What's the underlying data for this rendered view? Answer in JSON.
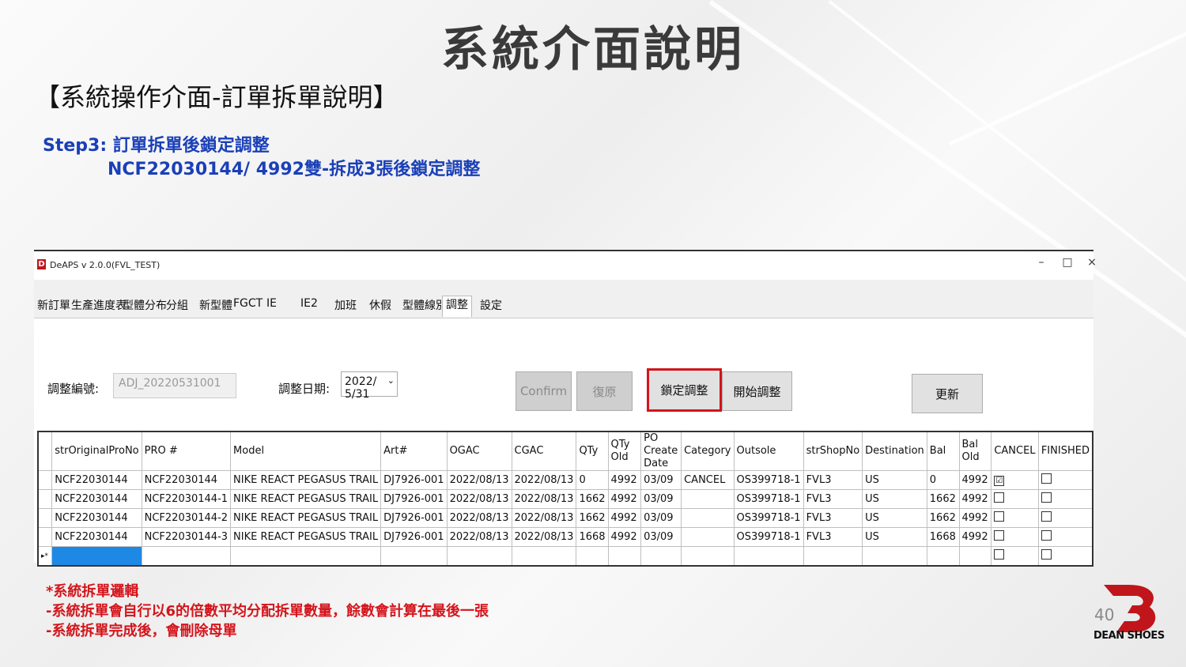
{
  "slide": {
    "title": "系統介面說明",
    "subtitle": "【系統操作介面-訂單拆單說明】",
    "step_line1": "Step3: 訂單拆單後鎖定調整",
    "step_line2": "NCF22030144/ 4992雙-拆成3張後鎖定調整",
    "notes": [
      "*系統拆單邏輯",
      "-系統拆單會自行以6的倍數平均分配拆單數量，餘數會計算在最後一張",
      "-系統拆單完成後，會刪除母單"
    ],
    "page_number": "40",
    "logo_text": "DEAN SHOES"
  },
  "window": {
    "title": "DeAPS v 2.0.0(FVL_TEST)",
    "minimize": "–",
    "maximize": "□",
    "close": "×"
  },
  "tabs": [
    {
      "label": "新訂單"
    },
    {
      "label": "生產進度表"
    },
    {
      "label": "型體分布"
    },
    {
      "label": "分組"
    },
    {
      "label": "新型體"
    },
    {
      "label": "FGCT"
    },
    {
      "label": "IE"
    },
    {
      "label": "IE2"
    },
    {
      "label": "加班"
    },
    {
      "label": "休假"
    },
    {
      "label": "型體線別"
    },
    {
      "label": "調整",
      "active": true
    },
    {
      "label": "設定"
    }
  ],
  "form": {
    "adjust_no_label": "調整編號:",
    "adjust_no_value": "ADJ_20220531001",
    "adjust_date_label": "調整日期:",
    "adjust_date_value": "2022/ 5/31",
    "dropdown_arrow": "⌄",
    "confirm": "Confirm",
    "restore": "復原",
    "lock_adjust": "鎖定調整",
    "start_adjust": "開始調整",
    "refresh": "更新"
  },
  "grid": {
    "headers": [
      "strOriginalProNo",
      "PRO #",
      "Model",
      "Art#",
      "OGAC",
      "CGAC",
      "QTy",
      "QTy Old",
      "PO Create Date",
      "Category",
      "Outsole",
      "strShopNo",
      "Destination",
      "Bal",
      "Bal Old",
      "CANCEL",
      "FINISHED"
    ],
    "rows": [
      {
        "cells": [
          "NCF22030144",
          "NCF22030144",
          "NIKE REACT PEGASUS TRAIL",
          "DJ7926-001",
          "2022/08/13",
          "2022/08/13",
          "0",
          "4992",
          "03/09",
          "CANCEL",
          "OS399718-1",
          "FVL3",
          "US",
          "0",
          "4992"
        ],
        "cancel": "☑",
        "finished": ""
      },
      {
        "cells": [
          "NCF22030144",
          "NCF22030144-1",
          "NIKE REACT PEGASUS TRAIL",
          "DJ7926-001",
          "2022/08/13",
          "2022/08/13",
          "1662",
          "4992",
          "03/09",
          "",
          "OS399718-1",
          "FVL3",
          "US",
          "1662",
          "4992"
        ],
        "cancel": "",
        "finished": ""
      },
      {
        "cells": [
          "NCF22030144",
          "NCF22030144-2",
          "NIKE REACT PEGASUS TRAIL",
          "DJ7926-001",
          "2022/08/13",
          "2022/08/13",
          "1662",
          "4992",
          "03/09",
          "",
          "OS399718-1",
          "FVL3",
          "US",
          "1662",
          "4992"
        ],
        "cancel": "",
        "finished": ""
      },
      {
        "cells": [
          "NCF22030144",
          "NCF22030144-3",
          "NIKE REACT PEGASUS TRAIL",
          "DJ7926-001",
          "2022/08/13",
          "2022/08/13",
          "1668",
          "4992",
          "03/09",
          "",
          "OS399718-1",
          "FVL3",
          "US",
          "1668",
          "4992"
        ],
        "cancel": "",
        "finished": ""
      }
    ],
    "new_row_marker": "▸*"
  },
  "colors": {
    "title": "#3a3a3a",
    "step": "#1a3fb8",
    "notes": "#d4141b",
    "highlight_border": "#d4141b",
    "selected_cell": "#1e88e5"
  }
}
